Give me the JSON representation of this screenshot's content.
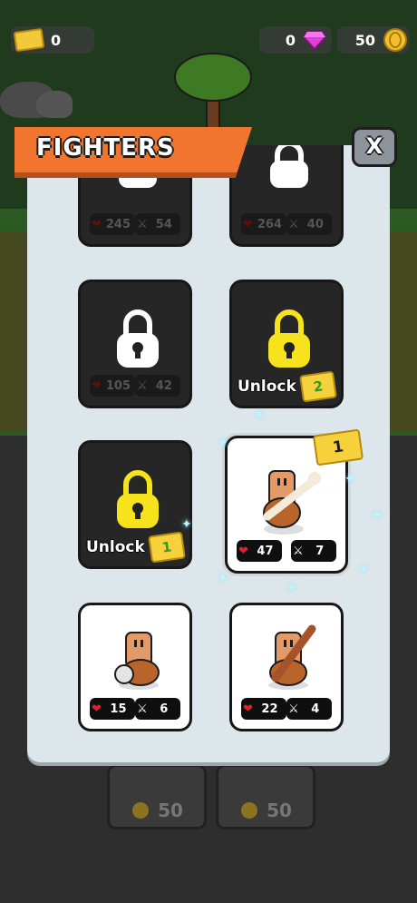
{
  "hud": {
    "tickets": "0",
    "gems": "0",
    "coins": "50"
  },
  "title": "FIGHTERS",
  "close_label": "X",
  "fighters": [
    {
      "hp": "245",
      "atk": "54"
    },
    {
      "hp": "264",
      "atk": "40"
    },
    {
      "hp": "105",
      "atk": "42"
    },
    {
      "unlock_label": "Unlock",
      "cost": "2"
    },
    {
      "unlock_label": "Unlock",
      "cost": "1"
    },
    {
      "hp": "47",
      "atk": "7",
      "ticket": "1"
    },
    {
      "hp": "15",
      "atk": "6"
    },
    {
      "hp": "22",
      "atk": "4"
    }
  ],
  "shop": [
    {
      "price": "50"
    },
    {
      "price": "50"
    }
  ],
  "colors": {
    "banner": "#f1752e",
    "panel": "#dde6ea",
    "card_locked": "#262626",
    "ticket": "#f6d13b"
  }
}
